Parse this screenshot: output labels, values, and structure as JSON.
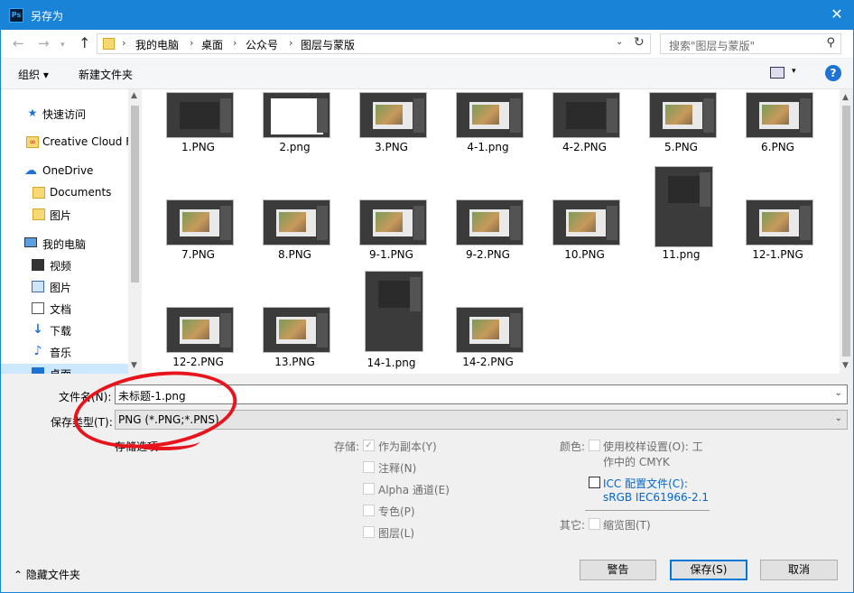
{
  "window": {
    "title": "另存为",
    "app_icon_text": "Ps"
  },
  "nav": {
    "breadcrumb": [
      "我的电脑",
      "桌面",
      "公众号",
      "图层与蒙版"
    ],
    "search_placeholder": "搜索\"图层与蒙版\""
  },
  "toolbar": {
    "organize_label": "组织 ▾",
    "new_folder_label": "新建文件夹"
  },
  "sidebar": {
    "items": [
      {
        "label": "快速访问",
        "icon": "star-icon"
      },
      {
        "label": "Creative Cloud F",
        "icon": "creative-cloud-icon"
      },
      {
        "label": "OneDrive",
        "icon": "cloud-icon"
      },
      {
        "label": "Documents",
        "icon": "folder-icon"
      },
      {
        "label": "图片",
        "icon": "folder-icon"
      },
      {
        "label": "我的电脑",
        "icon": "computer-icon"
      },
      {
        "label": "视频",
        "icon": "video-icon"
      },
      {
        "label": "图片",
        "icon": "picture-icon"
      },
      {
        "label": "文档",
        "icon": "document-icon"
      },
      {
        "label": "下载",
        "icon": "download-icon"
      },
      {
        "label": "音乐",
        "icon": "music-icon"
      },
      {
        "label": "桌面",
        "icon": "desktop-icon"
      }
    ]
  },
  "files": [
    "1.PNG",
    "2.png",
    "3.PNG",
    "4-1.png",
    "4-2.PNG",
    "5.PNG",
    "6.PNG",
    "7.PNG",
    "8.PNG",
    "9-1.PNG",
    "9-2.PNG",
    "10.PNG",
    "11.png",
    "12-1.PNG",
    "12-2.PNG",
    "13.PNG",
    "14-1.png",
    "14-2.PNG"
  ],
  "save": {
    "filename_label": "文件名(N):",
    "filename_value": "未标题-1.png",
    "type_label": "保存类型(T):",
    "type_value": "PNG (*.PNG;*.PNS)",
    "storage_options_label": "存储选项"
  },
  "options": {
    "store_label": "存储:",
    "as_copy": "作为副本(Y)",
    "notes": "注释(N)",
    "alpha": "Alpha 通道(E)",
    "spot": "专色(P)",
    "layers": "图层(L)",
    "color_label": "颜色:",
    "proof_line1": "使用校样设置(O): 工",
    "proof_line2": "作中的 CMYK",
    "icc_line1": "ICC 配置文件(C):",
    "icc_line2": "sRGB IEC61966-2.1",
    "other_label": "其它:",
    "thumbnail": "缩览图(T)"
  },
  "buttons": {
    "warning": "警告",
    "save": "保存(S)",
    "cancel": "取消",
    "hide_folders": "隐藏文件夹"
  },
  "colors": {
    "titlebar": "#1883d7",
    "annotation": "#e8141c",
    "link": "#0066cc"
  }
}
